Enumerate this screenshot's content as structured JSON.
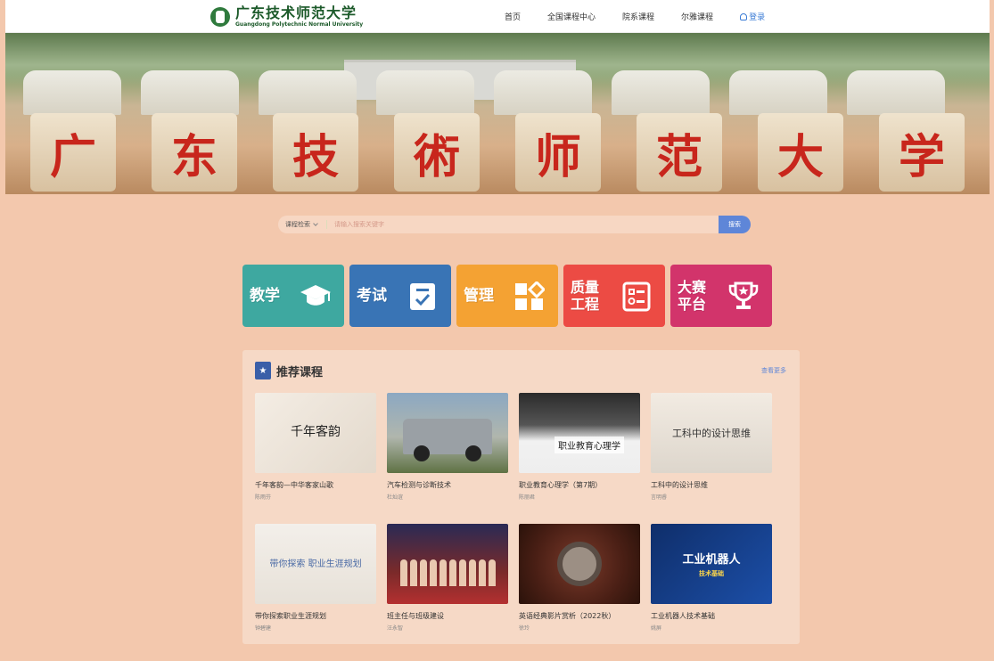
{
  "header": {
    "logo_cn": "广东技术师范大学",
    "logo_en": "Guangdong Polytechnic Normal University",
    "nav": [
      {
        "label": "首页"
      },
      {
        "label": "全国课程中心"
      },
      {
        "label": "院系课程"
      },
      {
        "label": "尔雅课程"
      }
    ],
    "login_label": "登录"
  },
  "banner": {
    "characters": [
      "广",
      "东",
      "技",
      "術",
      "师",
      "范",
      "大",
      "学"
    ]
  },
  "search": {
    "category": "课程检索",
    "placeholder": "请输入搜索关键字",
    "button_label": "搜索"
  },
  "platforms": [
    {
      "label": "教学",
      "icon": "graduation-cap-icon",
      "color": "#3ea8a0"
    },
    {
      "label": "考试",
      "icon": "checklist-icon",
      "color": "#3974b5"
    },
    {
      "label": "管理",
      "icon": "grid-manage-icon",
      "color": "#f4a233"
    },
    {
      "label": "质量工程",
      "icon": "form-list-icon",
      "color": "#ec4b44"
    },
    {
      "label": "大赛平台",
      "icon": "trophy-icon",
      "color": "#d2346b"
    }
  ],
  "recommended": {
    "title": "推荐课程",
    "see_more": "查看更多",
    "courses": [
      {
        "title": "千年客韵—中华客家山歌",
        "teacher": "陈雨芬",
        "thumb_text": "千年客韵"
      },
      {
        "title": "汽车检测与诊断技术",
        "teacher": "杜灿谊",
        "thumb_text": ""
      },
      {
        "title": "职业教育心理学（第7期）",
        "teacher": "陈丽君",
        "thumb_text": "职业教育心理学"
      },
      {
        "title": "工科中的设计思维",
        "teacher": "言明睿",
        "thumb_text": "工科中的设计思维"
      },
      {
        "title": "带你探索职业生涯规划",
        "teacher": "钟碧建",
        "thumb_text": "带你探索 职业生涯规划"
      },
      {
        "title": "班主任与班级建设",
        "teacher": "汪永智",
        "thumb_text": ""
      },
      {
        "title": "英语经典影片赏析（2022秋）",
        "teacher": "徐玲",
        "thumb_text": ""
      },
      {
        "title": "工业机器人技术基础",
        "teacher": "姚屏",
        "thumb_text": "工业机器人",
        "thumb_sub": "技术基础"
      }
    ]
  }
}
